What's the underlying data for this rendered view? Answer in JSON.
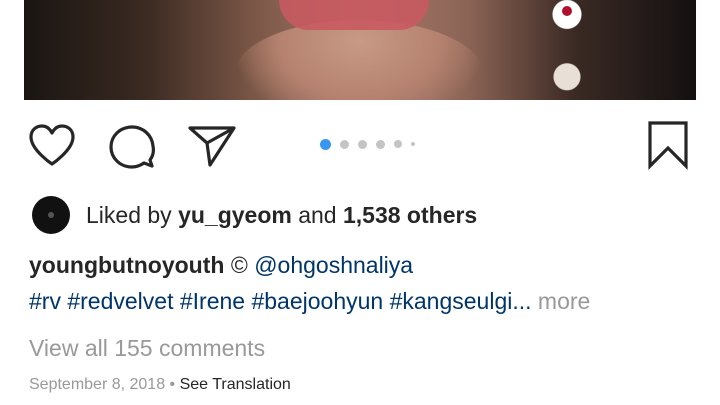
{
  "post": {
    "carousel": {
      "total": 6,
      "active_index": 0
    },
    "likes": {
      "prefix": "Liked by",
      "user": "yu_gyeom",
      "connector": "and",
      "count": "1,538 others"
    },
    "caption": {
      "username": "youngbutnoyouth",
      "symbol": "©",
      "mention": "@ohgoshnaliya"
    },
    "hashtags": [
      "#rv",
      "#redvelvet",
      "#Irene",
      "#baejoohyun",
      "#kangseulgi"
    ],
    "ellipsis": "...",
    "more_label": "more",
    "comments_label": "View all 155 comments",
    "date": "September 8, 2018",
    "separator": "•",
    "translate_label": "See Translation"
  },
  "actions": {
    "like": "heart-icon",
    "comment": "comment-icon",
    "share": "share-icon",
    "save": "bookmark-icon"
  },
  "colors": {
    "accent": "#3897f0",
    "link": "#003569",
    "muted": "#999999",
    "text": "#262626"
  }
}
